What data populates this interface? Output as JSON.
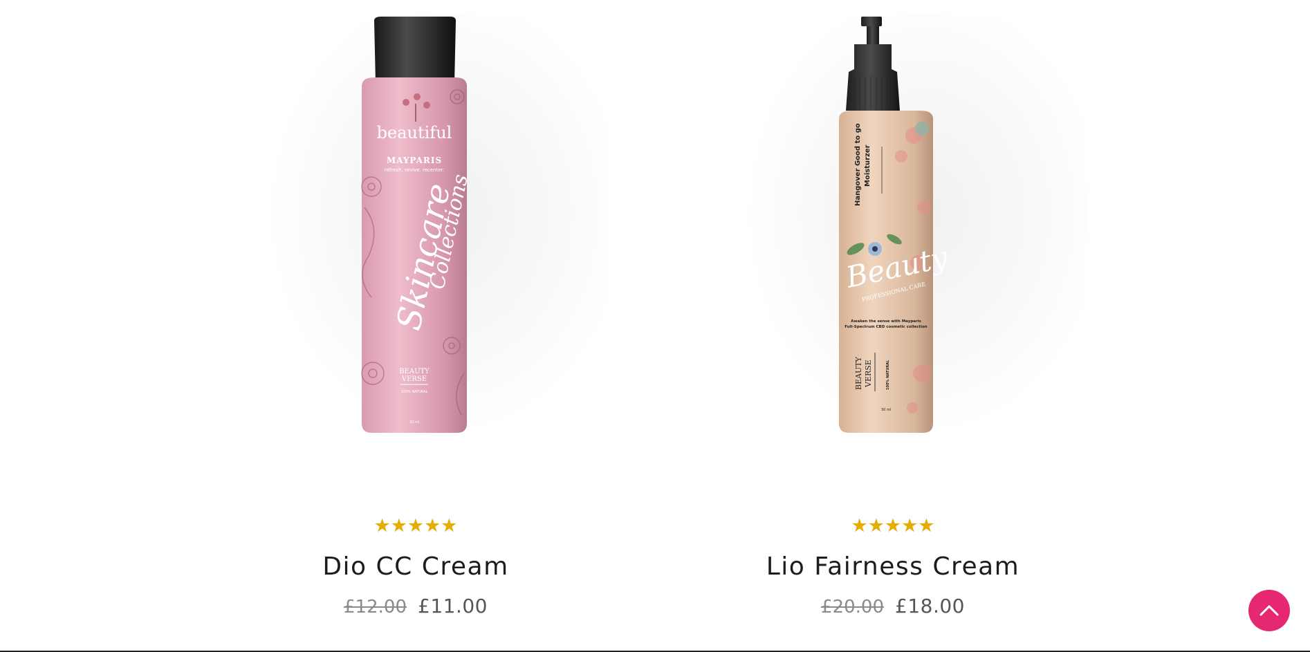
{
  "products": [
    {
      "name": "Dio CC Cream",
      "rating": 5,
      "rating_max": 5,
      "stars": "★★★★★",
      "price_old": "£12.00",
      "price_new": "£11.00",
      "image": {
        "brand": "beautiful",
        "line": "MAYPARIS",
        "tagline": "refresh. revive. recenter.",
        "script_1": "Skincare",
        "script_2": "Collections",
        "badge_1": "BEAUTY",
        "badge_2": "VERSE",
        "natural": "100% NATURAL",
        "volume": "30 ml",
        "body_color": "#e8b3c2",
        "cap_color": "#222222"
      }
    },
    {
      "name": "Lio Fairness Cream",
      "rating": 5,
      "rating_max": 5,
      "stars": "★★★★★",
      "price_old": "£20.00",
      "price_new": "£18.00",
      "image": {
        "vertical_1": "Hangover Good to go",
        "vertical_2": "Moisturzer",
        "script": "Beauty",
        "banner": "PROFESSIONAL CARE",
        "desc_1": "Awaken the sense with Mayparis",
        "desc_2": "Full-Spectrum CBD cosmetic collection",
        "badge_1": "BEAUTY",
        "badge_2": "VERSE",
        "natural": "100% NATURAL",
        "volume": "30 ml",
        "body_color": "#e8c8ae",
        "cap_color": "#2b2b2b"
      }
    }
  ],
  "scroll_top": {
    "icon": "chevron-up-icon",
    "color": "#e5286f"
  }
}
